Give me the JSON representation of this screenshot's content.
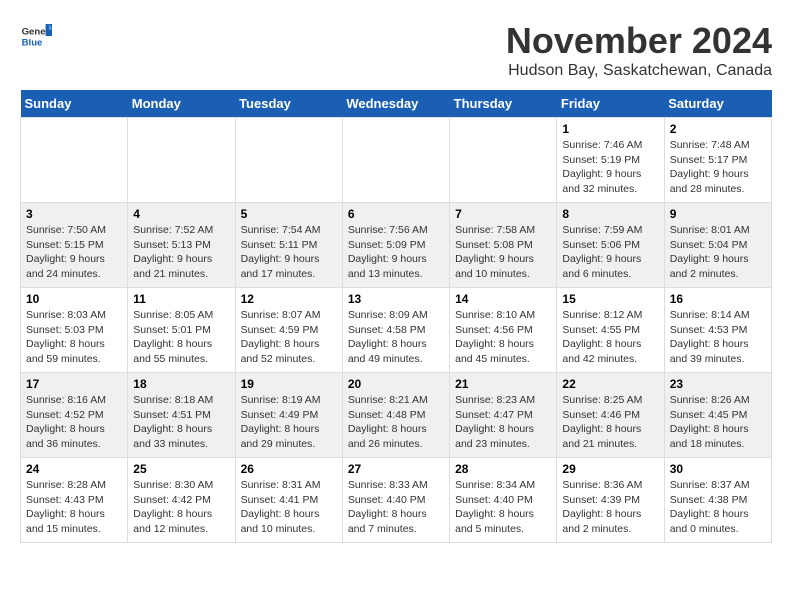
{
  "header": {
    "logo_general": "General",
    "logo_blue": "Blue",
    "month_year": "November 2024",
    "location": "Hudson Bay, Saskatchewan, Canada"
  },
  "weekdays": [
    "Sunday",
    "Monday",
    "Tuesday",
    "Wednesday",
    "Thursday",
    "Friday",
    "Saturday"
  ],
  "weeks": [
    [
      {
        "day": "",
        "sunrise": "",
        "sunset": "",
        "daylight": ""
      },
      {
        "day": "",
        "sunrise": "",
        "sunset": "",
        "daylight": ""
      },
      {
        "day": "",
        "sunrise": "",
        "sunset": "",
        "daylight": ""
      },
      {
        "day": "",
        "sunrise": "",
        "sunset": "",
        "daylight": ""
      },
      {
        "day": "",
        "sunrise": "",
        "sunset": "",
        "daylight": ""
      },
      {
        "day": "1",
        "sunrise": "Sunrise: 7:46 AM",
        "sunset": "Sunset: 5:19 PM",
        "daylight": "Daylight: 9 hours and 32 minutes."
      },
      {
        "day": "2",
        "sunrise": "Sunrise: 7:48 AM",
        "sunset": "Sunset: 5:17 PM",
        "daylight": "Daylight: 9 hours and 28 minutes."
      }
    ],
    [
      {
        "day": "3",
        "sunrise": "Sunrise: 7:50 AM",
        "sunset": "Sunset: 5:15 PM",
        "daylight": "Daylight: 9 hours and 24 minutes."
      },
      {
        "day": "4",
        "sunrise": "Sunrise: 7:52 AM",
        "sunset": "Sunset: 5:13 PM",
        "daylight": "Daylight: 9 hours and 21 minutes."
      },
      {
        "day": "5",
        "sunrise": "Sunrise: 7:54 AM",
        "sunset": "Sunset: 5:11 PM",
        "daylight": "Daylight: 9 hours and 17 minutes."
      },
      {
        "day": "6",
        "sunrise": "Sunrise: 7:56 AM",
        "sunset": "Sunset: 5:09 PM",
        "daylight": "Daylight: 9 hours and 13 minutes."
      },
      {
        "day": "7",
        "sunrise": "Sunrise: 7:58 AM",
        "sunset": "Sunset: 5:08 PM",
        "daylight": "Daylight: 9 hours and 10 minutes."
      },
      {
        "day": "8",
        "sunrise": "Sunrise: 7:59 AM",
        "sunset": "Sunset: 5:06 PM",
        "daylight": "Daylight: 9 hours and 6 minutes."
      },
      {
        "day": "9",
        "sunrise": "Sunrise: 8:01 AM",
        "sunset": "Sunset: 5:04 PM",
        "daylight": "Daylight: 9 hours and 2 minutes."
      }
    ],
    [
      {
        "day": "10",
        "sunrise": "Sunrise: 8:03 AM",
        "sunset": "Sunset: 5:03 PM",
        "daylight": "Daylight: 8 hours and 59 minutes."
      },
      {
        "day": "11",
        "sunrise": "Sunrise: 8:05 AM",
        "sunset": "Sunset: 5:01 PM",
        "daylight": "Daylight: 8 hours and 55 minutes."
      },
      {
        "day": "12",
        "sunrise": "Sunrise: 8:07 AM",
        "sunset": "Sunset: 4:59 PM",
        "daylight": "Daylight: 8 hours and 52 minutes."
      },
      {
        "day": "13",
        "sunrise": "Sunrise: 8:09 AM",
        "sunset": "Sunset: 4:58 PM",
        "daylight": "Daylight: 8 hours and 49 minutes."
      },
      {
        "day": "14",
        "sunrise": "Sunrise: 8:10 AM",
        "sunset": "Sunset: 4:56 PM",
        "daylight": "Daylight: 8 hours and 45 minutes."
      },
      {
        "day": "15",
        "sunrise": "Sunrise: 8:12 AM",
        "sunset": "Sunset: 4:55 PM",
        "daylight": "Daylight: 8 hours and 42 minutes."
      },
      {
        "day": "16",
        "sunrise": "Sunrise: 8:14 AM",
        "sunset": "Sunset: 4:53 PM",
        "daylight": "Daylight: 8 hours and 39 minutes."
      }
    ],
    [
      {
        "day": "17",
        "sunrise": "Sunrise: 8:16 AM",
        "sunset": "Sunset: 4:52 PM",
        "daylight": "Daylight: 8 hours and 36 minutes."
      },
      {
        "day": "18",
        "sunrise": "Sunrise: 8:18 AM",
        "sunset": "Sunset: 4:51 PM",
        "daylight": "Daylight: 8 hours and 33 minutes."
      },
      {
        "day": "19",
        "sunrise": "Sunrise: 8:19 AM",
        "sunset": "Sunset: 4:49 PM",
        "daylight": "Daylight: 8 hours and 29 minutes."
      },
      {
        "day": "20",
        "sunrise": "Sunrise: 8:21 AM",
        "sunset": "Sunset: 4:48 PM",
        "daylight": "Daylight: 8 hours and 26 minutes."
      },
      {
        "day": "21",
        "sunrise": "Sunrise: 8:23 AM",
        "sunset": "Sunset: 4:47 PM",
        "daylight": "Daylight: 8 hours and 23 minutes."
      },
      {
        "day": "22",
        "sunrise": "Sunrise: 8:25 AM",
        "sunset": "Sunset: 4:46 PM",
        "daylight": "Daylight: 8 hours and 21 minutes."
      },
      {
        "day": "23",
        "sunrise": "Sunrise: 8:26 AM",
        "sunset": "Sunset: 4:45 PM",
        "daylight": "Daylight: 8 hours and 18 minutes."
      }
    ],
    [
      {
        "day": "24",
        "sunrise": "Sunrise: 8:28 AM",
        "sunset": "Sunset: 4:43 PM",
        "daylight": "Daylight: 8 hours and 15 minutes."
      },
      {
        "day": "25",
        "sunrise": "Sunrise: 8:30 AM",
        "sunset": "Sunset: 4:42 PM",
        "daylight": "Daylight: 8 hours and 12 minutes."
      },
      {
        "day": "26",
        "sunrise": "Sunrise: 8:31 AM",
        "sunset": "Sunset: 4:41 PM",
        "daylight": "Daylight: 8 hours and 10 minutes."
      },
      {
        "day": "27",
        "sunrise": "Sunrise: 8:33 AM",
        "sunset": "Sunset: 4:40 PM",
        "daylight": "Daylight: 8 hours and 7 minutes."
      },
      {
        "day": "28",
        "sunrise": "Sunrise: 8:34 AM",
        "sunset": "Sunset: 4:40 PM",
        "daylight": "Daylight: 8 hours and 5 minutes."
      },
      {
        "day": "29",
        "sunrise": "Sunrise: 8:36 AM",
        "sunset": "Sunset: 4:39 PM",
        "daylight": "Daylight: 8 hours and 2 minutes."
      },
      {
        "day": "30",
        "sunrise": "Sunrise: 8:37 AM",
        "sunset": "Sunset: 4:38 PM",
        "daylight": "Daylight: 8 hours and 0 minutes."
      }
    ]
  ]
}
